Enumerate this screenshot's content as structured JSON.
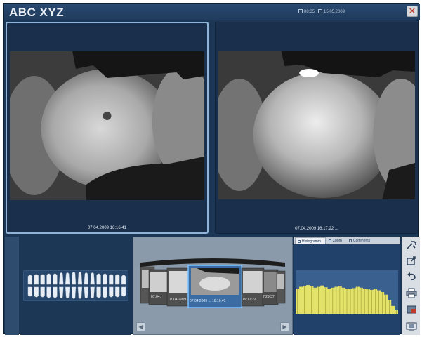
{
  "window": {
    "title": "ABC XYZ",
    "status_time": "08:35",
    "status_date": "15.05.2009",
    "close_glyph": "✕"
  },
  "panels": {
    "left_timestamp": "07.04.2009 16:16:41",
    "right_timestamp": "07.04.2009 16:17:22 ..."
  },
  "filmstrip": {
    "thumb_labels": [
      "07.04.",
      "07.04.2009 ...",
      "07.04.2009 ... 16:16:41",
      "19:17:22",
      "7:29:37"
    ],
    "selected_label": "07.04.2009 ... 16:16:41",
    "left_arrow": "◀",
    "right_arrow": "▶"
  },
  "info_tabs": [
    {
      "label": "Histogramm",
      "icon": "histogram-icon",
      "active": true
    },
    {
      "label": "Zoom",
      "icon": "zoom-icon",
      "active": false
    },
    {
      "label": "Comments",
      "icon": "comments-icon",
      "active": false
    }
  ],
  "histogram": {
    "bins": [
      0.58,
      0.62,
      0.64,
      0.66,
      0.63,
      0.6,
      0.62,
      0.65,
      0.61,
      0.58,
      0.6,
      0.62,
      0.64,
      0.6,
      0.58,
      0.57,
      0.59,
      0.62,
      0.6,
      0.58,
      0.56,
      0.55,
      0.57,
      0.54,
      0.5,
      0.44,
      0.32,
      0.18,
      0.08
    ],
    "colors": {
      "fill": "#e3e36a",
      "line": "#8a8a28",
      "background": "#3a6090"
    }
  },
  "toolbar": {
    "icons": [
      "tools-icon",
      "export-icon",
      "undo-icon",
      "print-icon",
      "image-select-icon",
      "screen-capture-icon"
    ]
  },
  "colors": {
    "accent_border": "#8fb4d9",
    "window_bg": "#1c3655"
  }
}
